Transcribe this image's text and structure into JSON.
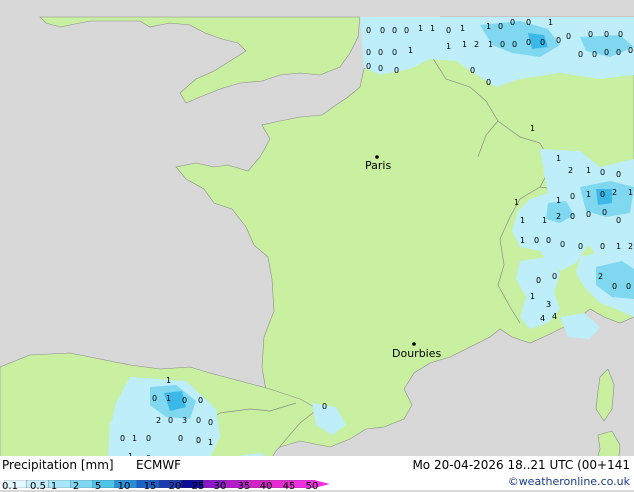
{
  "map": {
    "cities": [
      {
        "name": "Paris"
      },
      {
        "name": "Dourbies"
      }
    ],
    "precip_labels": [
      "0",
      "0",
      "0",
      "0",
      "1",
      "1",
      "0",
      "1",
      "1",
      "0",
      "0",
      "0",
      "1",
      "0",
      "0",
      "0",
      "0",
      "0",
      "0",
      "0",
      "1",
      "1",
      "1",
      "2",
      "1",
      "0",
      "0",
      "0",
      "0",
      "0",
      "0",
      "0",
      "0",
      "0",
      "0",
      "0",
      "0",
      "0",
      "0",
      "0",
      "1",
      "1",
      "2",
      "1",
      "0",
      "0",
      "1",
      "1",
      "0",
      "1",
      "0",
      "2",
      "1",
      "1",
      "1",
      "2",
      "0",
      "0",
      "0",
      "0",
      "1",
      "0",
      "0",
      "0",
      "0",
      "0",
      "1",
      "2",
      "0",
      "0",
      "2",
      "0",
      "0",
      "1",
      "3",
      "4",
      "4",
      "1",
      "0",
      "1",
      "0",
      "0",
      "2",
      "0",
      "3",
      "0",
      "0",
      "0",
      "1",
      "0",
      "0",
      "0",
      "1",
      "1",
      "0",
      "1",
      "0",
      "1",
      "0",
      "0"
    ],
    "colors": {
      "land": "#c8f0a0",
      "sea": "#d8d8d8",
      "border": "#8c8c8c",
      "precip_light": "#bdeefa",
      "precip_medium": "#7fd8f0",
      "precip_heavy": "#3cb8e8"
    }
  },
  "footer": {
    "title": "Precipitation [mm]",
    "model": "ECMWF",
    "valid_time": "Mo 20-04-2026 18..21 UTC (00+141",
    "credit": "©weatheronline.co.uk"
  },
  "legend": {
    "ticks": [
      "0.1",
      "0.5",
      "1",
      "2",
      "5",
      "10",
      "15",
      "20",
      "25",
      "30",
      "35",
      "40",
      "45",
      "50"
    ],
    "colors": [
      "#e6f8ff",
      "#c8f0fc",
      "#a6e6f8",
      "#7ed8f2",
      "#4cc4ec",
      "#2a90d8",
      "#1f60c8",
      "#1a3cb0",
      "#0c0c96",
      "#8a18c8",
      "#b41ec8",
      "#d224c8",
      "#e62ad2",
      "#f030e0"
    ]
  }
}
